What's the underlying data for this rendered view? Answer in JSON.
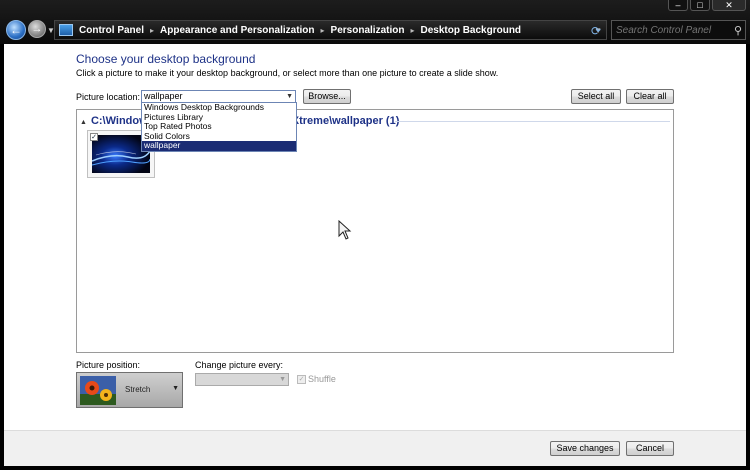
{
  "window": {
    "min_glyph": "–",
    "max_glyph": "□",
    "close_glyph": "✕"
  },
  "address_bar": {
    "back_glyph": "←",
    "forward_glyph": "→",
    "breadcrumbs": [
      "Control Panel",
      "Appearance and Personalization",
      "Personalization",
      "Desktop Background"
    ],
    "separator_glyph": "▸",
    "icon": "control-panel-icon"
  },
  "search": {
    "placeholder": "Search Control Panel",
    "icon": "search-icon"
  },
  "main": {
    "heading": "Choose your desktop background",
    "subtext": "Click a picture to make it your desktop background, or select more than one picture to create a slide show.",
    "picture_location_label": "Picture location:",
    "picture_location_value": "wallpaper",
    "browse_label": "Browse...",
    "select_all_label": "Select all",
    "clear_all_label": "Clear all",
    "location_options": [
      "Windows Desktop Backgrounds",
      "Pictures Library",
      "Top Rated Photos",
      "Solid Colors",
      "wallpaper"
    ],
    "selected_option_index": 4,
    "group_header_left": "C:\\Windows",
    "group_header_right": "Xtreme\\wallpaper (1)",
    "thumbnail_checked": true,
    "picture_position_label": "Picture position:",
    "picture_position_value": "Stretch",
    "change_picture_label": "Change picture every:",
    "change_picture_value": "",
    "shuffle_label": "Shuffle"
  },
  "footer": {
    "save_label": "Save changes",
    "cancel_label": "Cancel"
  },
  "colors": {
    "heading": "#1e3287",
    "selection": "#1b2c74",
    "titlebar": "#0a0a0a"
  }
}
